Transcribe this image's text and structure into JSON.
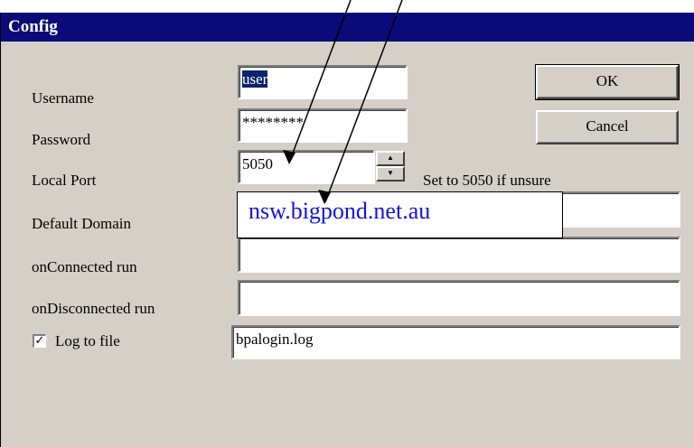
{
  "window": {
    "title": "Config"
  },
  "fields": {
    "username": {
      "label": "Username",
      "value": "user"
    },
    "password": {
      "label": "Password",
      "value": "********"
    },
    "local_port": {
      "label": "Local Port",
      "value": "5050",
      "hint": "Set to 5050 if unsure"
    },
    "default_domain": {
      "label": "Default Domain",
      "value": ""
    },
    "on_connected": {
      "label": "onConnected run",
      "value": ""
    },
    "on_disconnected": {
      "label": "onDisconnected run",
      "value": ""
    },
    "log_to_file": {
      "label": "Log to file",
      "checked": true,
      "value": "bpalogin.log"
    }
  },
  "buttons": {
    "ok": "OK",
    "cancel": "Cancel"
  },
  "annotation": {
    "text": "nsw.bigpond.net.au",
    "color": "#1414e6"
  },
  "icons": {
    "spin_up": "spin-up-icon",
    "spin_down": "spin-down-icon",
    "check": "✓"
  }
}
